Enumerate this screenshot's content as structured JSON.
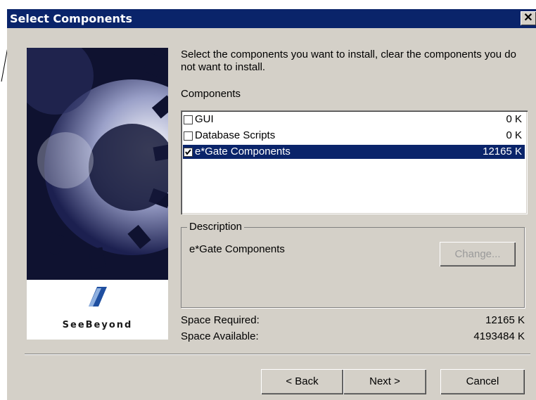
{
  "window": {
    "title": "Select Components",
    "close_glyph": "✕"
  },
  "intro_text": "Select the components you want to install, clear the components you do not want to install.",
  "components_label": "Components",
  "components": [
    {
      "name": "GUI",
      "size": "0 K",
      "checked": false,
      "selected": false
    },
    {
      "name": "Database Scripts",
      "size": "0 K",
      "checked": false,
      "selected": false
    },
    {
      "name": "e*Gate Components",
      "size": "12165 K",
      "checked": true,
      "selected": true
    }
  ],
  "description": {
    "legend": "Description",
    "text": "e*Gate Components",
    "change_label": "Change..."
  },
  "space": {
    "required_label": "Space Required:",
    "required_value": "12165 K",
    "available_label": "Space Available:",
    "available_value": "4193484 K"
  },
  "branding": {
    "logo_text": "SeeBeyond"
  },
  "buttons": {
    "back": "< Back",
    "next": "Next >",
    "cancel": "Cancel"
  },
  "colors": {
    "title_bar": "#0a246a",
    "selection": "#0a246a",
    "dialog_bg": "#d4d0c8"
  }
}
